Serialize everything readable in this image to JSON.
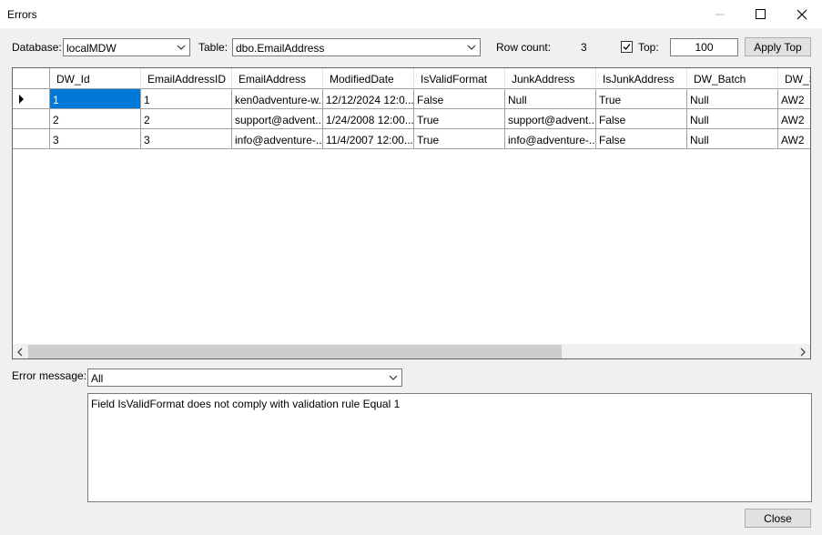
{
  "window": {
    "title": "Errors"
  },
  "toolbar": {
    "database_label": "Database:",
    "database_value": "localMDW",
    "table_label": "Table:",
    "table_value": "dbo.EmailAddress",
    "rowcount_label": "Row count:",
    "rowcount_value": "3",
    "top_label": "Top:",
    "top_checked": true,
    "top_value": "100",
    "apply_top_label": "Apply Top"
  },
  "grid": {
    "columns": [
      "DW_Id",
      "EmailAddressID",
      "EmailAddress",
      "ModifiedDate",
      "IsValidFormat",
      "JunkAddress",
      "IsJunkAddress",
      "DW_Batch",
      "DW_S"
    ],
    "rows": [
      [
        "1",
        "1",
        "ken0adventure-w...",
        "12/12/2024 12:0...",
        "False",
        "Null",
        "True",
        "Null",
        "AW2"
      ],
      [
        "2",
        "2",
        "support@advent...",
        "1/24/2008 12:00...",
        "True",
        "support@advent...",
        "False",
        "Null",
        "AW2"
      ],
      [
        "3",
        "3",
        "info@adventure-...",
        "11/4/2007 12:00...",
        "True",
        "info@adventure-...",
        "False",
        "Null",
        "AW2"
      ]
    ],
    "selected_row": 0
  },
  "error": {
    "label": "Error message:",
    "filter_value": "All",
    "message": "Field IsValidFormat does not comply with validation rule Equal 1"
  },
  "footer": {
    "close_label": "Close"
  }
}
